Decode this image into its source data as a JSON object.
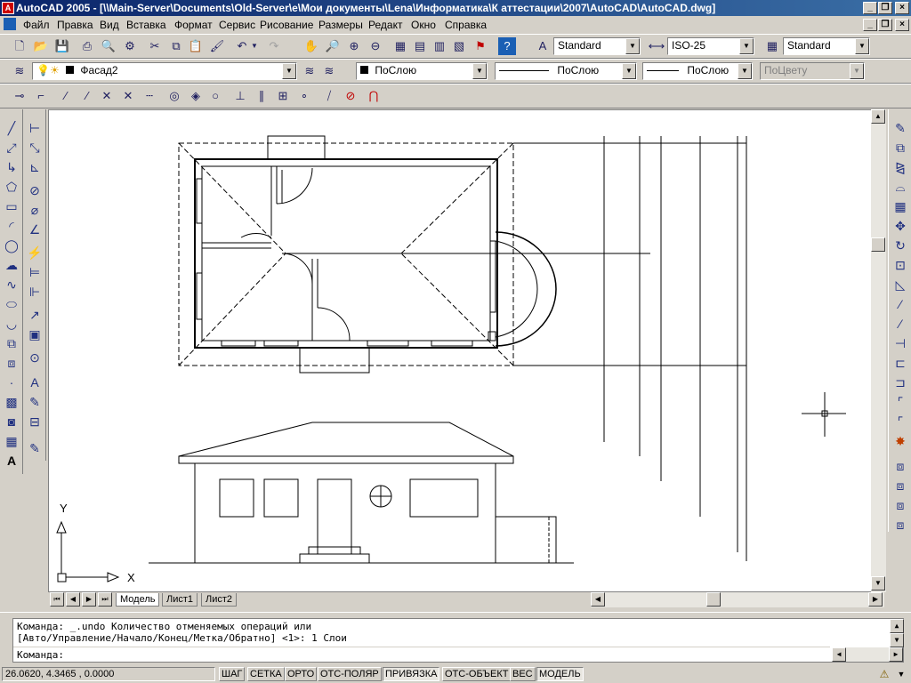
{
  "window": {
    "title": "AutoCAD 2005 - [\\\\Main-Server\\Documents\\Old-Server\\e\\Мои документы\\Lena\\Информатика\\К аттестации\\2007\\AutoCAD\\AutoCAD.dwg]",
    "icon_label": "A"
  },
  "menu": [
    "Файл",
    "Правка",
    "Вид",
    "Вставка",
    "Формат",
    "Сервис",
    "Рисование",
    "Размеры",
    "Редакт",
    "Окно",
    "Справка"
  ],
  "styles_toolbar": {
    "text_style": "Standard",
    "dim_style": "ISO-25",
    "table_style": "Standard"
  },
  "layers_toolbar": {
    "layer_name": "Фасад2",
    "color": "ПоСлою",
    "linetype": "ПоСлою",
    "lineweight": "ПоСлою",
    "plotstyle": "ПоЦвету"
  },
  "ucs": {
    "x_label": "X",
    "y_label": "Y"
  },
  "tabs": [
    "Модель",
    "Лист1",
    "Лист2"
  ],
  "active_tab": "Модель",
  "command": {
    "line1": "Команда: _.undo Количество отменяемых операций или",
    "line2": "[Авто/Управление/Начало/Конец/Метка/Обратно] <1>: 1 Слои",
    "prompt": "Команда:"
  },
  "status": {
    "coords": "26.0620, 4.3465 , 0.0000",
    "toggles": [
      "ШАГ",
      "СЕТКА",
      "ОРТО",
      "ОТС-ПОЛЯР",
      "ПРИВЯЗКА",
      "ОТС-ОБЪЕКТ",
      "ВЕС",
      "МОДЕЛЬ"
    ],
    "active_toggles": [
      "ПРИВЯЗКА",
      "МОДЕЛЬ"
    ]
  },
  "colors": {
    "title_start": "#0a246a",
    "title_end": "#3a6ea5",
    "ui_face": "#d4d0c8",
    "canvas": "#ffffff"
  }
}
